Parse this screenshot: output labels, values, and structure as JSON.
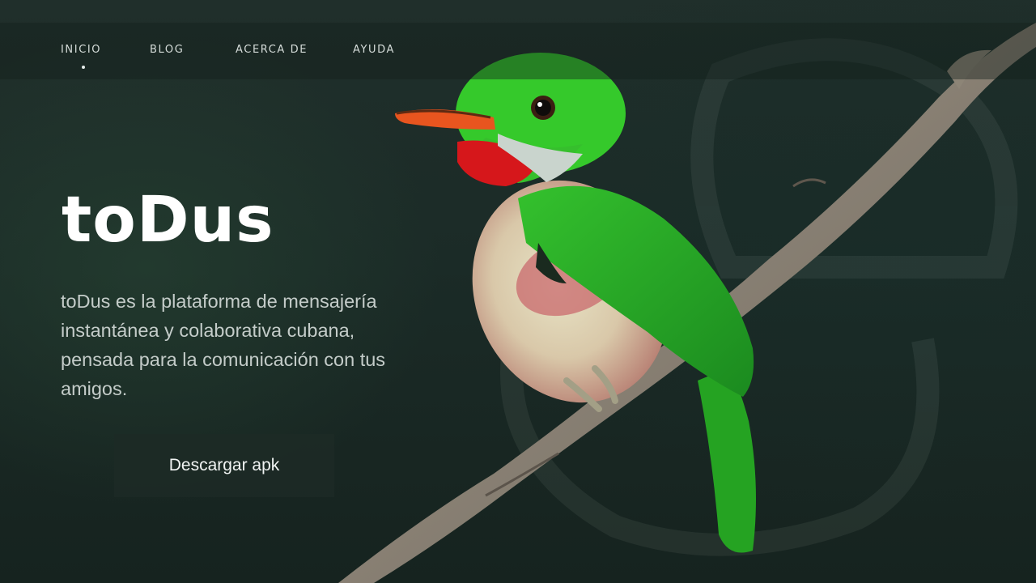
{
  "nav": {
    "items": [
      {
        "label": "INICIO",
        "active": true
      },
      {
        "label": "BLOG"
      },
      {
        "label": "ACERCA  DE"
      },
      {
        "label": "AYUDA"
      }
    ]
  },
  "hero": {
    "title": "toDus",
    "description": "toDus es la plataforma de mensajería instantánea y colaborativa cubana, pensada para la comunicación con tus amigos.",
    "cta_label": "Descargar apk",
    "image": "tody-bird-on-branch"
  },
  "colors": {
    "background": "#1b2b27",
    "bird_green": "#2fbf2a",
    "bird_red": "#d11a1a",
    "text": "#ffffff"
  }
}
